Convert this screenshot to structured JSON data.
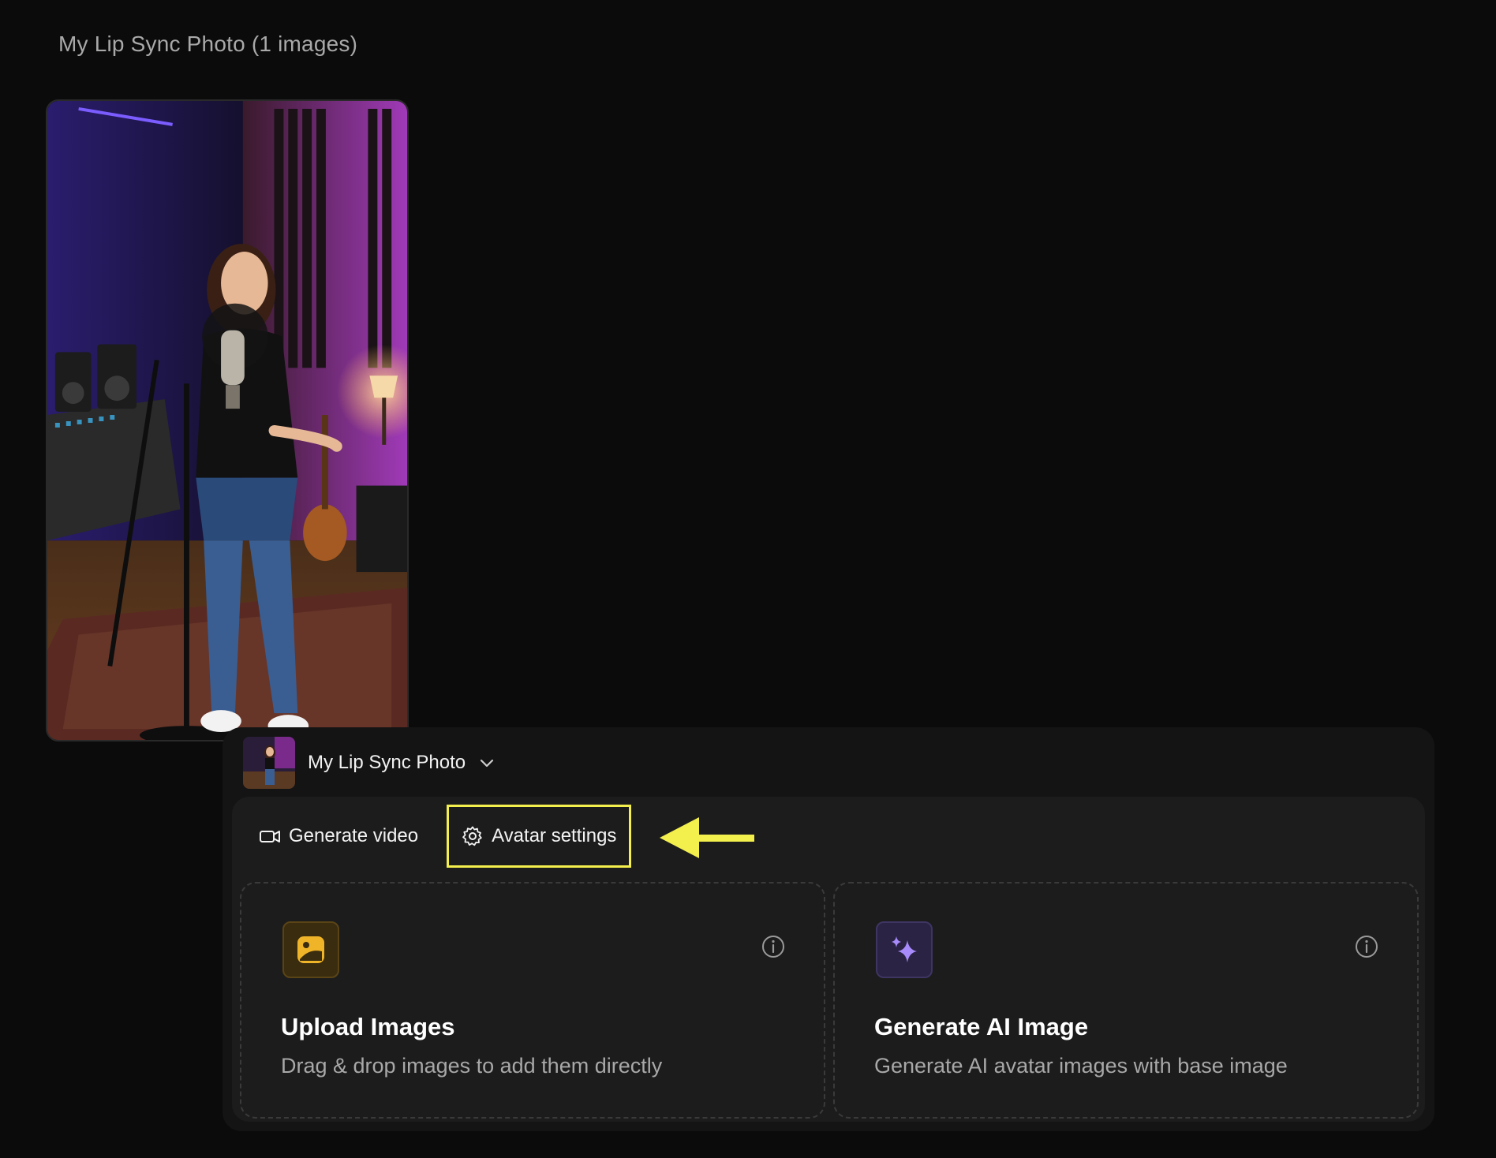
{
  "gallery": {
    "title": "My Lip Sync Photo (1 images)",
    "photo_icon": "singer-studio-photo"
  },
  "panel": {
    "avatar_name": "My Lip Sync Photo",
    "avatar_thumb_icon": "avatar-thumbnail",
    "dropdown_icon": "chevron-down-icon"
  },
  "tabs": [
    {
      "label": "Generate video",
      "icon": "video-camera-icon"
    },
    {
      "label": "Avatar settings",
      "icon": "gear-icon"
    }
  ],
  "cards": [
    {
      "title": "Upload Images",
      "description": "Drag & drop images to add them directly",
      "icon": "image-upload-icon",
      "info_icon": "info-icon"
    },
    {
      "title": "Generate AI Image",
      "description": "Generate AI avatar images with base image",
      "icon": "sparkles-icon",
      "info_icon": "info-icon"
    }
  ],
  "colors": {
    "highlight": "#f3ef4d",
    "upload_accent": "#f0b429",
    "ai_accent": "#a78bfa"
  }
}
